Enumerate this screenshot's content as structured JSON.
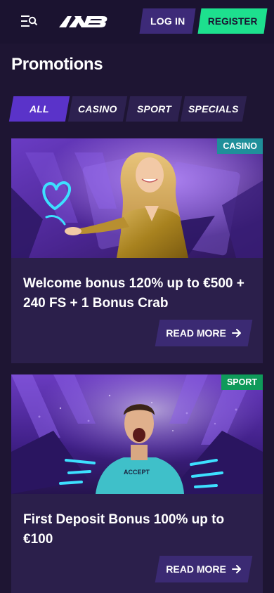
{
  "header": {
    "login_label": "LOG IN",
    "register_label": "REGISTER",
    "accent_register": "#1de08e"
  },
  "page": {
    "title": "Promotions"
  },
  "filters": {
    "tabs": [
      {
        "label": "ALL",
        "active": true
      },
      {
        "label": "CASINO",
        "active": false
      },
      {
        "label": "SPORT",
        "active": false
      },
      {
        "label": "SPECIALS",
        "active": false
      }
    ]
  },
  "promotions": [
    {
      "badge": "CASINO",
      "badge_color": "#1f8f9a",
      "title": "Welcome bonus 120% up to €500 + 240 FS + 1 Bonus Crab",
      "cta_label": "READ MORE",
      "image": "woman-in-gold-dress-with-heart"
    },
    {
      "badge": "SPORT",
      "badge_color": "#0f9a5a",
      "title": "First Deposit Bonus 100% up to €100",
      "cta_label": "READ MORE",
      "image": "footballer-celebrating",
      "jersey_text": "ACCEPT"
    }
  ]
}
